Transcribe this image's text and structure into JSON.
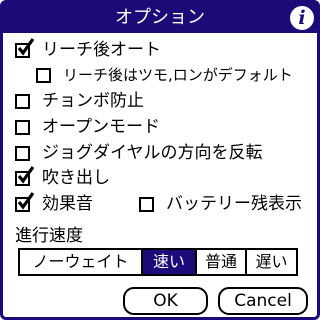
{
  "dialog": {
    "title": "オプション",
    "info_icon": "info-icon"
  },
  "options": {
    "auto_riichi": {
      "label": "リーチ後オート",
      "checked": true
    },
    "riichi_tsumo_ron_default": {
      "label": "リーチ後はツモ,ロンがデフォルト",
      "checked": false
    },
    "prevent_chonbo": {
      "label": "チョンボ防止",
      "checked": false
    },
    "open_mode": {
      "label": "オープンモード",
      "checked": false
    },
    "reverse_jog_dial": {
      "label": "ジョグダイヤルの方向を反転",
      "checked": false
    },
    "speech_bubble": {
      "label": "吹き出し",
      "checked": true
    },
    "sound_effects": {
      "label": "効果音",
      "checked": true
    },
    "battery_display": {
      "label": "バッテリー残表示",
      "checked": false
    }
  },
  "speed": {
    "label": "進行速度",
    "options": [
      "ノーウェイト",
      "速い",
      "普通",
      "遅い"
    ],
    "selected": "速い"
  },
  "buttons": {
    "ok": "OK",
    "cancel": "Cancel"
  },
  "colors": {
    "accent": "#1c0a78",
    "background": "#ffffff"
  }
}
